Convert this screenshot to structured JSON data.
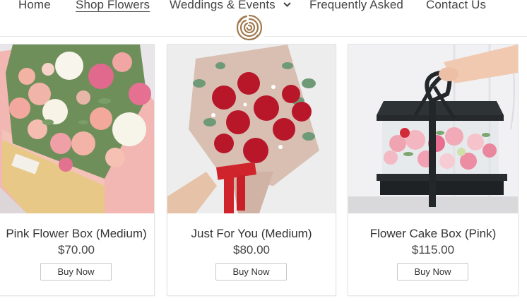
{
  "nav": {
    "items": [
      {
        "label": "Home"
      },
      {
        "label": "Shop Flowers"
      },
      {
        "label": "Weddings & Events"
      },
      {
        "label": "Frequently Asked"
      },
      {
        "label": "Contact Us"
      }
    ],
    "logo_icon": "rose-logo-icon"
  },
  "products": [
    {
      "title": "Pink Flower Box (Medium)",
      "price": "$70.00",
      "button": "Buy Now"
    },
    {
      "title": "Just For You (Medium)",
      "price": "$80.00",
      "button": "Buy Now"
    },
    {
      "title": "Flower Cake Box (Pink)",
      "price": "$115.00",
      "button": "Buy Now"
    }
  ],
  "colors": {
    "logo": "#a07a4e",
    "button_border": "#c9c9c9",
    "text": "#333333"
  }
}
